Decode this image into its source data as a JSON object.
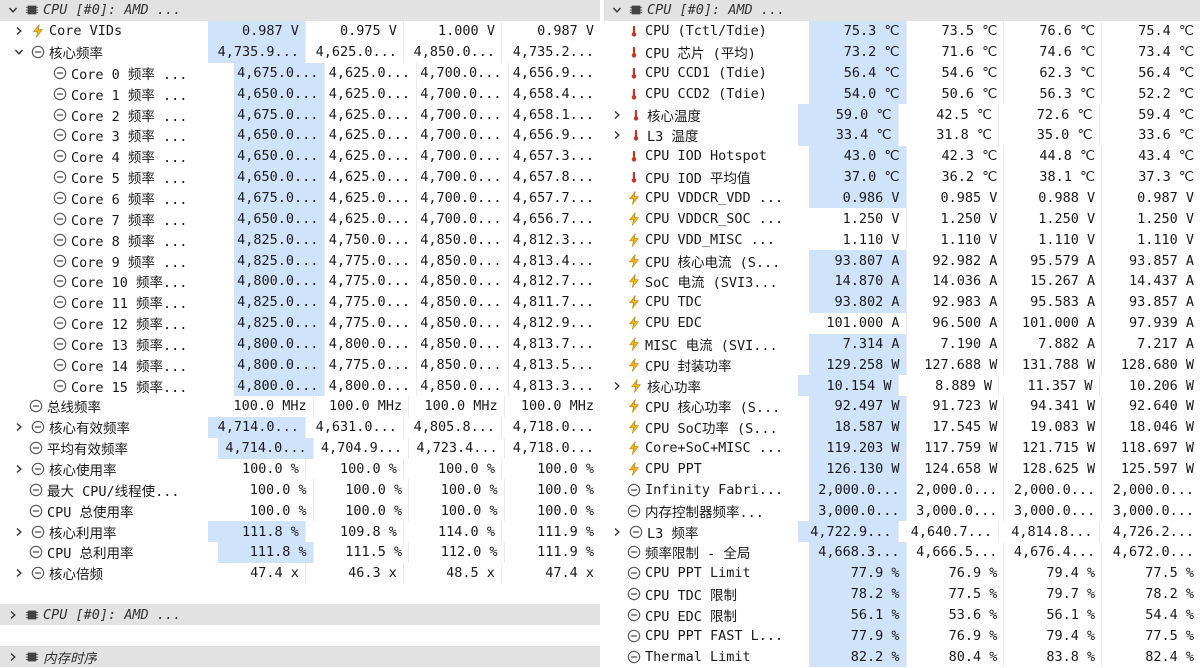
{
  "colors": {
    "highlight": "#cfe3fb",
    "group_header": "#e2e2e2",
    "bolt": "#f2b318",
    "thermo": "#c0392b",
    "clock": "#555555"
  },
  "left": {
    "rows": [
      {
        "type": "group",
        "chev": "down",
        "icon": "chip-icon",
        "name": "CPU [#0]: AMD ...",
        "indent": 0
      },
      {
        "chev": "right",
        "icon": "bolt-icon",
        "name": "Core VIDs",
        "indent": 1,
        "vals": [
          "0.987 V",
          "0.975 V",
          "1.000 V",
          "0.987 V"
        ]
      },
      {
        "chev": "down",
        "icon": "clock-icon",
        "name": "核心频率",
        "indent": 1,
        "vals": [
          "4,735.9...",
          "4,625.0...",
          "4,850.0...",
          "4,735.2..."
        ]
      },
      {
        "icon": "clock-icon",
        "name": "Core 0 频率 ...",
        "indent": 2,
        "vals": [
          "4,675.0...",
          "4,625.0...",
          "4,700.0...",
          "4,656.9..."
        ]
      },
      {
        "icon": "clock-icon",
        "name": "Core 1 频率 ...",
        "indent": 2,
        "vals": [
          "4,650.0...",
          "4,625.0...",
          "4,700.0...",
          "4,658.4..."
        ]
      },
      {
        "icon": "clock-icon",
        "name": "Core 2 频率 ...",
        "indent": 2,
        "vals": [
          "4,675.0...",
          "4,625.0...",
          "4,700.0...",
          "4,658.1..."
        ]
      },
      {
        "icon": "clock-icon",
        "name": "Core 3 频率 ...",
        "indent": 2,
        "vals": [
          "4,650.0...",
          "4,625.0...",
          "4,700.0...",
          "4,656.9..."
        ]
      },
      {
        "icon": "clock-icon",
        "name": "Core 4 频率 ...",
        "indent": 2,
        "vals": [
          "4,650.0...",
          "4,625.0...",
          "4,700.0...",
          "4,657.3..."
        ]
      },
      {
        "icon": "clock-icon",
        "name": "Core 5 频率 ...",
        "indent": 2,
        "vals": [
          "4,650.0...",
          "4,625.0...",
          "4,700.0...",
          "4,657.8..."
        ]
      },
      {
        "icon": "clock-icon",
        "name": "Core 6 频率 ...",
        "indent": 2,
        "vals": [
          "4,675.0...",
          "4,625.0...",
          "4,700.0...",
          "4,657.7..."
        ]
      },
      {
        "icon": "clock-icon",
        "name": "Core 7 频率 ...",
        "indent": 2,
        "vals": [
          "4,650.0...",
          "4,625.0...",
          "4,700.0...",
          "4,656.7..."
        ]
      },
      {
        "icon": "clock-icon",
        "name": "Core 8 频率 ...",
        "indent": 2,
        "vals": [
          "4,825.0...",
          "4,750.0...",
          "4,850.0...",
          "4,812.3..."
        ]
      },
      {
        "icon": "clock-icon",
        "name": "Core 9 频率 ...",
        "indent": 2,
        "vals": [
          "4,825.0...",
          "4,775.0...",
          "4,850.0...",
          "4,813.4..."
        ]
      },
      {
        "icon": "clock-icon",
        "name": "Core 10 频率...",
        "indent": 2,
        "vals": [
          "4,800.0...",
          "4,775.0...",
          "4,850.0...",
          "4,812.7..."
        ]
      },
      {
        "icon": "clock-icon",
        "name": "Core 11 频率...",
        "indent": 2,
        "vals": [
          "4,825.0...",
          "4,775.0...",
          "4,850.0...",
          "4,811.7..."
        ]
      },
      {
        "icon": "clock-icon",
        "name": "Core 12 频率...",
        "indent": 2,
        "vals": [
          "4,825.0...",
          "4,775.0...",
          "4,850.0...",
          "4,812.9..."
        ]
      },
      {
        "icon": "clock-icon",
        "name": "Core 13 频率...",
        "indent": 2,
        "vals": [
          "4,800.0...",
          "4,800.0...",
          "4,850.0...",
          "4,813.7..."
        ]
      },
      {
        "icon": "clock-icon",
        "name": "Core 14 频率...",
        "indent": 2,
        "vals": [
          "4,800.0...",
          "4,775.0...",
          "4,850.0...",
          "4,813.5..."
        ]
      },
      {
        "icon": "clock-icon",
        "name": "Core 15 频率...",
        "indent": 2,
        "vals": [
          "4,800.0...",
          "4,800.0...",
          "4,850.0...",
          "4,813.3..."
        ]
      },
      {
        "icon": "clock-icon",
        "name": "总线频率",
        "indent": 0,
        "nohl": true,
        "vals": [
          "100.0 MHz",
          "100.0 MHz",
          "100.0 MHz",
          "100.0 MHz"
        ]
      },
      {
        "chev": "right",
        "icon": "clock-icon",
        "name": "核心有效频率",
        "indent": 1,
        "vals": [
          "4,714.0...",
          "4,631.0...",
          "4,805.8...",
          "4,718.0..."
        ]
      },
      {
        "icon": "clock-icon",
        "name": "平均有效频率",
        "indent": 0,
        "vals": [
          "4,714.0...",
          "4,704.9...",
          "4,723.4...",
          "4,718.0..."
        ]
      },
      {
        "chev": "right",
        "icon": "clock-icon",
        "name": "核心使用率",
        "indent": 1,
        "nohl": true,
        "vals": [
          "100.0 %",
          "100.0 %",
          "100.0 %",
          "100.0 %"
        ]
      },
      {
        "icon": "clock-icon",
        "name": "最大 CPU/线程使...",
        "indent": 0,
        "nohl": true,
        "vals": [
          "100.0 %",
          "100.0 %",
          "100.0 %",
          "100.0 %"
        ]
      },
      {
        "icon": "clock-icon",
        "name": "CPU 总使用率",
        "indent": 0,
        "nohl": true,
        "vals": [
          "100.0 %",
          "100.0 %",
          "100.0 %",
          "100.0 %"
        ]
      },
      {
        "chev": "right",
        "icon": "clock-icon",
        "name": "核心利用率",
        "indent": 1,
        "vals": [
          "111.8 %",
          "109.8 %",
          "114.0 %",
          "111.9 %"
        ]
      },
      {
        "icon": "clock-icon",
        "name": "CPU 总利用率",
        "indent": 0,
        "vals": [
          "111.8 %",
          "111.5 %",
          "112.0 %",
          "111.9 %"
        ]
      },
      {
        "chev": "right",
        "icon": "clock-icon",
        "name": "核心倍频",
        "indent": 1,
        "nohl": true,
        "vals": [
          "47.4 x",
          "46.3 x",
          "48.5 x",
          "47.4 x"
        ]
      },
      {
        "type": "blank"
      },
      {
        "type": "group",
        "chev": "right",
        "icon": "chip-icon",
        "name": "CPU [#0]: AMD ...",
        "indent": 0
      },
      {
        "type": "blank"
      },
      {
        "type": "group",
        "chev": "right",
        "icon": "chip-icon",
        "name": "内存时序",
        "indent": 0
      }
    ]
  },
  "right": {
    "rows": [
      {
        "type": "group",
        "chev": "down",
        "icon": "chip-icon",
        "name": "CPU [#0]: AMD ..."
      },
      {
        "icon": "thermo-icon",
        "name": "CPU (Tctl/Tdie)",
        "vals": [
          "75.3 ℃",
          "73.5 ℃",
          "76.6 ℃",
          "75.4 ℃"
        ]
      },
      {
        "icon": "thermo-icon",
        "name": "CPU 芯片 (平均)",
        "vals": [
          "73.2 ℃",
          "71.6 ℃",
          "74.6 ℃",
          "73.4 ℃"
        ]
      },
      {
        "icon": "thermo-icon",
        "name": "CPU CCD1 (Tdie)",
        "vals": [
          "56.4 ℃",
          "54.6 ℃",
          "62.3 ℃",
          "56.4 ℃"
        ]
      },
      {
        "icon": "thermo-icon",
        "name": "CPU CCD2 (Tdie)",
        "vals": [
          "54.0 ℃",
          "50.6 ℃",
          "56.3 ℃",
          "52.2 ℃"
        ]
      },
      {
        "chev": "right",
        "icon": "thermo-icon",
        "name": "核心温度",
        "vals": [
          "59.0 ℃",
          "42.5 ℃",
          "72.6 ℃",
          "59.4 ℃"
        ]
      },
      {
        "chev": "right",
        "icon": "thermo-icon",
        "name": "L3 温度",
        "vals": [
          "33.4 ℃",
          "31.8 ℃",
          "35.0 ℃",
          "33.6 ℃"
        ]
      },
      {
        "icon": "thermo-icon",
        "name": "CPU IOD Hotspot",
        "vals": [
          "43.0 ℃",
          "42.3 ℃",
          "44.8 ℃",
          "43.4 ℃"
        ]
      },
      {
        "icon": "thermo-icon",
        "name": "CPU IOD 平均值",
        "vals": [
          "37.0 ℃",
          "36.2 ℃",
          "38.1 ℃",
          "37.3 ℃"
        ]
      },
      {
        "icon": "bolt-icon",
        "name": "CPU VDDCR_VDD ...",
        "vals": [
          "0.986 V",
          "0.985 V",
          "0.988 V",
          "0.987 V"
        ]
      },
      {
        "icon": "bolt-icon",
        "name": "CPU VDDCR_SOC ...",
        "nohl": true,
        "vals": [
          "1.250 V",
          "1.250 V",
          "1.250 V",
          "1.250 V"
        ]
      },
      {
        "icon": "bolt-icon",
        "name": "CPU VDD_MISC ...",
        "nohl": true,
        "vals": [
          "1.110 V",
          "1.110 V",
          "1.110 V",
          "1.110 V"
        ]
      },
      {
        "icon": "bolt-icon",
        "name": "CPU 核心电流 (S...",
        "vals": [
          "93.807 A",
          "92.982 A",
          "95.579 A",
          "93.857 A"
        ]
      },
      {
        "icon": "bolt-icon",
        "name": "SoC 电流 (SVI3...",
        "vals": [
          "14.870 A",
          "14.036 A",
          "15.267 A",
          "14.437 A"
        ]
      },
      {
        "icon": "bolt-icon",
        "name": "CPU TDC",
        "vals": [
          "93.802 A",
          "92.983 A",
          "95.583 A",
          "93.857 A"
        ]
      },
      {
        "icon": "bolt-icon",
        "name": "CPU EDC",
        "nohl": true,
        "vals": [
          "101.000 A",
          "96.500 A",
          "101.000 A",
          "97.939 A"
        ]
      },
      {
        "icon": "bolt-icon",
        "name": "MISC 电流 (SVI...",
        "vals": [
          "7.314 A",
          "7.190 A",
          "7.882 A",
          "7.217 A"
        ]
      },
      {
        "icon": "bolt-icon",
        "name": "CPU 封装功率",
        "vals": [
          "129.258 W",
          "127.688 W",
          "131.788 W",
          "128.680 W"
        ]
      },
      {
        "chev": "right",
        "icon": "bolt-icon",
        "name": "核心功率",
        "vals": [
          "10.154 W",
          "8.889 W",
          "11.357 W",
          "10.206 W"
        ]
      },
      {
        "icon": "bolt-icon",
        "name": "CPU 核心功率 (S...",
        "vals": [
          "92.497 W",
          "91.723 W",
          "94.341 W",
          "92.640 W"
        ]
      },
      {
        "icon": "bolt-icon",
        "name": "CPU SoC功率 (S...",
        "vals": [
          "18.587 W",
          "17.545 W",
          "19.083 W",
          "18.046 W"
        ]
      },
      {
        "icon": "bolt-icon",
        "name": "Core+SoC+MISC ...",
        "vals": [
          "119.203 W",
          "117.759 W",
          "121.715 W",
          "118.697 W"
        ]
      },
      {
        "icon": "bolt-icon",
        "name": "CPU PPT",
        "vals": [
          "126.130 W",
          "124.658 W",
          "128.625 W",
          "125.597 W"
        ]
      },
      {
        "icon": "clock-icon",
        "name": "Infinity Fabri...",
        "vals": [
          "2,000.0...",
          "2,000.0...",
          "2,000.0...",
          "2,000.0..."
        ]
      },
      {
        "icon": "clock-icon",
        "name": "内存控制器频率...",
        "vals": [
          "3,000.0...",
          "3,000.0...",
          "3,000.0...",
          "3,000.0..."
        ]
      },
      {
        "chev": "right",
        "icon": "clock-icon",
        "name": "L3 频率",
        "vals": [
          "4,722.9...",
          "4,640.7...",
          "4,814.8...",
          "4,726.2..."
        ]
      },
      {
        "icon": "clock-icon",
        "name": "频率限制 - 全局",
        "vals": [
          "4,668.3...",
          "4,666.5...",
          "4,676.4...",
          "4,672.0..."
        ]
      },
      {
        "icon": "clock-icon",
        "name": "CPU PPT Limit",
        "vals": [
          "77.9 %",
          "76.9 %",
          "79.4 %",
          "77.5 %"
        ]
      },
      {
        "icon": "clock-icon",
        "name": "CPU TDC 限制",
        "vals": [
          "78.2 %",
          "77.5 %",
          "79.7 %",
          "78.2 %"
        ]
      },
      {
        "icon": "clock-icon",
        "name": "CPU EDC 限制",
        "vals": [
          "56.1 %",
          "53.6 %",
          "56.1 %",
          "54.4 %"
        ]
      },
      {
        "icon": "clock-icon",
        "name": "CPU PPT FAST L...",
        "vals": [
          "77.9 %",
          "76.9 %",
          "79.4 %",
          "77.5 %"
        ]
      },
      {
        "icon": "clock-icon",
        "name": "Thermal Limit",
        "vals": [
          "82.2 %",
          "80.4 %",
          "83.8 %",
          "82.4 %"
        ]
      }
    ]
  }
}
